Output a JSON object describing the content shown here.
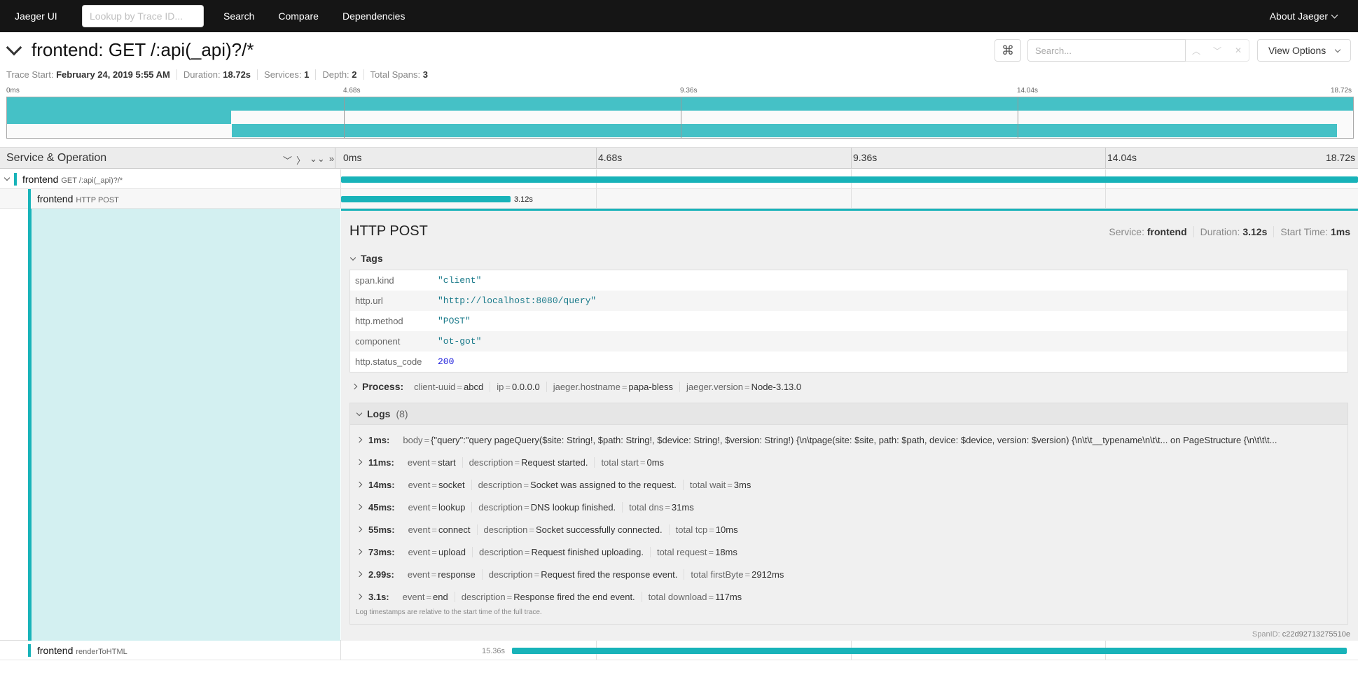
{
  "nav": {
    "brand": "Jaeger UI",
    "lookup_placeholder": "Lookup by Trace ID...",
    "links": [
      "Search",
      "Compare",
      "Dependencies"
    ],
    "about": "About Jaeger"
  },
  "trace": {
    "title": "frontend: GET /:api(_api)?/*",
    "search_placeholder": "Search...",
    "view_options": "View Options",
    "meta": {
      "trace_start_label": "Trace Start:",
      "trace_start_value": "February 24, 2019 5:55 AM",
      "duration_label": "Duration:",
      "duration_value": "18.72s",
      "services_label": "Services:",
      "services_value": "1",
      "depth_label": "Depth:",
      "depth_value": "2",
      "total_spans_label": "Total Spans:",
      "total_spans_value": "3"
    }
  },
  "minimap": {
    "ticks": [
      "0ms",
      "4.68s",
      "9.36s",
      "14.04s",
      "18.72s"
    ]
  },
  "span_header": {
    "label": "Service & Operation",
    "ticks": [
      "0ms",
      "4.68s",
      "9.36s",
      "14.04s",
      "18.72s"
    ]
  },
  "spans": [
    {
      "service": "frontend",
      "operation": "GET /:api(_api)?/*",
      "start_fraction": 0.0,
      "duration_fraction": 1.0,
      "label": ""
    },
    {
      "service": "frontend",
      "operation": "HTTP POST",
      "start_fraction": 0.0,
      "duration_fraction": 0.1667,
      "label": "3.12s"
    },
    {
      "service": "frontend",
      "operation": "renderToHTML",
      "start_fraction": 0.168,
      "duration_fraction": 0.82,
      "label": "15.36s"
    }
  ],
  "details": {
    "title": "HTTP POST",
    "service_label": "Service:",
    "service_value": "frontend",
    "duration_label": "Duration:",
    "duration_value": "3.12s",
    "start_label": "Start Time:",
    "start_value": "1ms",
    "tags_label": "Tags",
    "tags": [
      {
        "key": "span.kind",
        "value": "\"client\""
      },
      {
        "key": "http.url",
        "value": "\"http://localhost:8080/query\""
      },
      {
        "key": "http.method",
        "value": "\"POST\""
      },
      {
        "key": "component",
        "value": "\"ot-got\""
      },
      {
        "key": "http.status_code",
        "value": "200"
      }
    ],
    "process_label": "Process:",
    "process": [
      {
        "key": "client-uuid",
        "value": "abcd"
      },
      {
        "key": "ip",
        "value": "0.0.0.0"
      },
      {
        "key": "jaeger.hostname",
        "value": "papa-bless"
      },
      {
        "key": "jaeger.version",
        "value": "Node-3.13.0"
      }
    ],
    "logs_label": "Logs",
    "logs_count": "(8)",
    "logs": [
      {
        "ts": "1ms:",
        "fields": [
          {
            "key": "body",
            "value": "{\"query\":\"query pageQuery($site: String!, $path: String!, $device: String!, $version: String!) {\\n\\tpage(site: $site, path: $path, device: $device, version: $version) {\\n\\t\\t__typename\\n\\t\\t... on PageStructure {\\n\\t\\t\\t..."
          }
        ]
      },
      {
        "ts": "11ms:",
        "fields": [
          {
            "key": "event",
            "value": "start"
          },
          {
            "key": "description",
            "value": "Request started."
          },
          {
            "key": "total start",
            "value": "0ms"
          }
        ]
      },
      {
        "ts": "14ms:",
        "fields": [
          {
            "key": "event",
            "value": "socket"
          },
          {
            "key": "description",
            "value": "Socket was assigned to the request."
          },
          {
            "key": "total wait",
            "value": "3ms"
          }
        ]
      },
      {
        "ts": "45ms:",
        "fields": [
          {
            "key": "event",
            "value": "lookup"
          },
          {
            "key": "description",
            "value": "DNS lookup finished."
          },
          {
            "key": "total dns",
            "value": "31ms"
          }
        ]
      },
      {
        "ts": "55ms:",
        "fields": [
          {
            "key": "event",
            "value": "connect"
          },
          {
            "key": "description",
            "value": "Socket successfully connected."
          },
          {
            "key": "total tcp",
            "value": "10ms"
          }
        ]
      },
      {
        "ts": "73ms:",
        "fields": [
          {
            "key": "event",
            "value": "upload"
          },
          {
            "key": "description",
            "value": "Request finished uploading."
          },
          {
            "key": "total request",
            "value": "18ms"
          }
        ]
      },
      {
        "ts": "2.99s:",
        "fields": [
          {
            "key": "event",
            "value": "response"
          },
          {
            "key": "description",
            "value": "Request fired the response event."
          },
          {
            "key": "total firstByte",
            "value": "2912ms"
          }
        ]
      },
      {
        "ts": "3.1s:",
        "fields": [
          {
            "key": "event",
            "value": "end"
          },
          {
            "key": "description",
            "value": "Response fired the end event."
          },
          {
            "key": "total download",
            "value": "117ms"
          }
        ]
      }
    ],
    "logs_note": "Log timestamps are relative to the start time of the full trace.",
    "span_id_label": "SpanID:",
    "span_id_value": "c22d92713275510e"
  },
  "colors": {
    "accent": "#18b3b9",
    "nav_bg": "#151515",
    "detail_left": "#d3f0f1"
  }
}
